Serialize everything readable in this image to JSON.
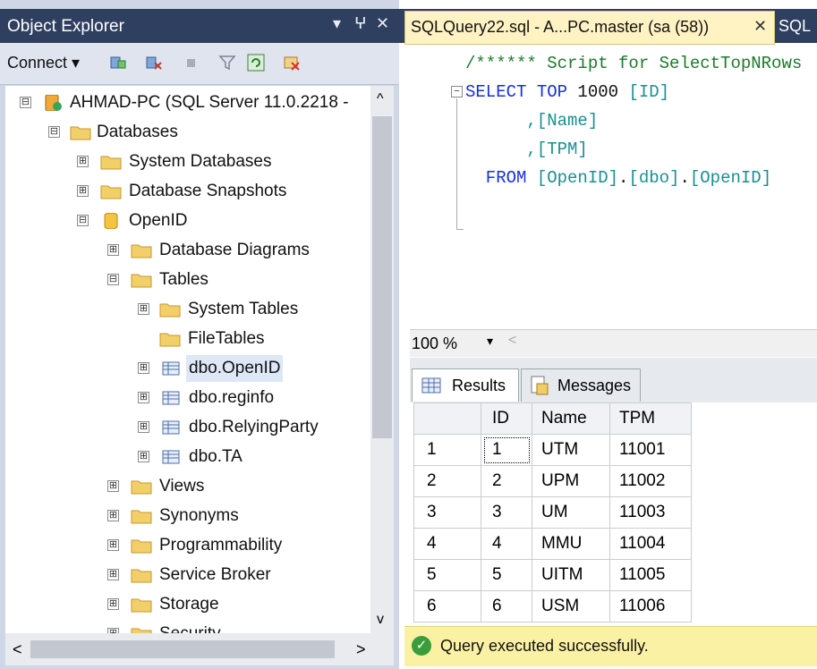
{
  "object_explorer": {
    "title": "Object Explorer",
    "title_controls": [
      "▾",
      "ⵖ",
      "✕"
    ],
    "connect_label": "Connect ▾",
    "tree": [
      {
        "label": "AHMAD-PC (SQL Server 11.0.2218 -",
        "expander": "⊟",
        "icon": "server-icon",
        "indent": 0
      },
      {
        "label": "Databases",
        "expander": "⊟",
        "icon": "folder-icon",
        "indent": 1
      },
      {
        "label": "System Databases",
        "expander": "⊞",
        "icon": "folder-icon",
        "indent": 2
      },
      {
        "label": "Database Snapshots",
        "expander": "⊞",
        "icon": "folder-icon",
        "indent": 2
      },
      {
        "label": "OpenID",
        "expander": "⊟",
        "icon": "database-icon",
        "indent": 2
      },
      {
        "label": "Database Diagrams",
        "expander": "⊞",
        "icon": "folder-icon",
        "indent": 3
      },
      {
        "label": "Tables",
        "expander": "⊟",
        "icon": "folder-icon",
        "indent": 3
      },
      {
        "label": "System Tables",
        "expander": "⊞",
        "icon": "folder-icon",
        "indent": 4
      },
      {
        "label": "FileTables",
        "expander": "",
        "icon": "folder-icon",
        "indent": 4
      },
      {
        "label": "dbo.OpenID",
        "expander": "⊞",
        "icon": "table-icon",
        "indent": 4
      },
      {
        "label": "dbo.reginfo",
        "expander": "⊞",
        "icon": "table-icon",
        "indent": 4
      },
      {
        "label": "dbo.RelyingParty",
        "expander": "⊞",
        "icon": "table-icon",
        "indent": 4
      },
      {
        "label": "dbo.TA",
        "expander": "⊞",
        "icon": "table-icon",
        "indent": 4
      },
      {
        "label": "Views",
        "expander": "⊞",
        "icon": "folder-icon",
        "indent": 3
      },
      {
        "label": "Synonyms",
        "expander": "⊞",
        "icon": "folder-icon",
        "indent": 3
      },
      {
        "label": "Programmability",
        "expander": "⊞",
        "icon": "folder-icon",
        "indent": 3
      },
      {
        "label": "Service Broker",
        "expander": "⊞",
        "icon": "folder-icon",
        "indent": 3
      },
      {
        "label": "Storage",
        "expander": "⊞",
        "icon": "folder-icon",
        "indent": 3
      },
      {
        "label": "Security",
        "expander": "⊞",
        "icon": "folder-icon",
        "indent": 3
      }
    ],
    "scroll_up": "^",
    "scroll_down": "v",
    "scroll_left": "<",
    "scroll_right": ">"
  },
  "query_tab": {
    "title": "SQLQuery22.sql - A...PC.master (sa (58))",
    "close": "✕",
    "next_tab": "SQL"
  },
  "editor": {
    "lines": [
      {
        "parts": [
          {
            "t": "/****** Script for SelectTopNRows",
            "c": "cmt"
          }
        ]
      },
      {
        "parts": [
          {
            "t": "SELECT TOP ",
            "c": "kw"
          },
          {
            "t": "1000 ",
            "c": "num"
          },
          {
            "t": "[ID]",
            "c": "br"
          }
        ]
      },
      {
        "parts": [
          {
            "t": "      ,[Name]",
            "c": "br"
          }
        ]
      },
      {
        "parts": [
          {
            "t": "      ,[TPM]",
            "c": "br"
          }
        ]
      },
      {
        "parts": [
          {
            "t": "  FROM ",
            "c": "kw"
          },
          {
            "t": "[OpenID]",
            "c": "br"
          },
          {
            "t": ".",
            "c": "num"
          },
          {
            "t": "[dbo]",
            "c": "br"
          },
          {
            "t": ".",
            "c": "num"
          },
          {
            "t": "[OpenID]",
            "c": "br"
          }
        ]
      }
    ],
    "fold_glyph": "−"
  },
  "zoom": {
    "value": "100 %",
    "arrow": "▾",
    "left": "<"
  },
  "results": {
    "tabs": [
      {
        "label": "Results"
      },
      {
        "label": "Messages"
      }
    ],
    "columns": [
      "",
      "ID",
      "Name",
      "TPM"
    ],
    "rows": [
      [
        "1",
        "1",
        "UTM",
        "11001"
      ],
      [
        "2",
        "2",
        "UPM",
        "11002"
      ],
      [
        "3",
        "3",
        "UM",
        "11003"
      ],
      [
        "4",
        "4",
        "MMU",
        "11004"
      ],
      [
        "5",
        "5",
        "UITM",
        "11005"
      ],
      [
        "6",
        "6",
        "USM",
        "11006"
      ]
    ]
  },
  "status": {
    "message": "Query executed successfully.",
    "icon": "✓"
  }
}
